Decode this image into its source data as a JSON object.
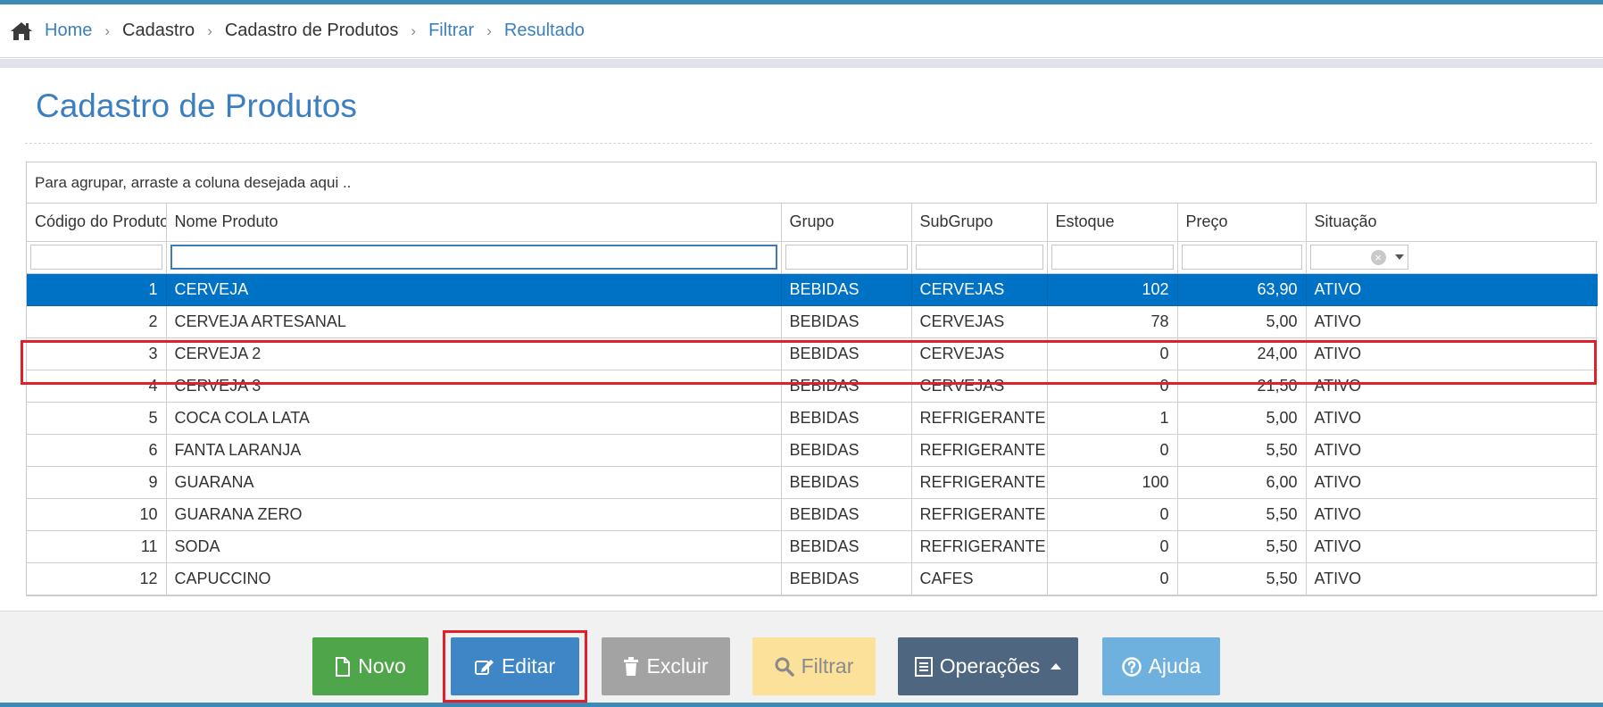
{
  "breadcrumb": {
    "items": [
      {
        "label": "Home"
      },
      {
        "label": "Cadastro"
      },
      {
        "label": "Cadastro de Produtos"
      },
      {
        "label": "Filtrar"
      },
      {
        "label": "Resultado"
      }
    ]
  },
  "page": {
    "title": "Cadastro de Produtos"
  },
  "grid": {
    "group_hint": "Para agrupar, arraste a coluna desejada aqui ..",
    "columns": [
      "Código do Produto",
      "Nome Produto",
      "Grupo",
      "SubGrupo",
      "Estoque",
      "Preço",
      "Situação"
    ],
    "rows": [
      {
        "codigo": "1",
        "nome": "CERVEJA",
        "grupo": "BEBIDAS",
        "subgrupo": "CERVEJAS",
        "estoque": "102",
        "preco": "63,90",
        "situacao": "ATIVO",
        "selected": true
      },
      {
        "codigo": "2",
        "nome": "CERVEJA ARTESANAL",
        "grupo": "BEBIDAS",
        "subgrupo": "CERVEJAS",
        "estoque": "78",
        "preco": "5,00",
        "situacao": "ATIVO"
      },
      {
        "codigo": "3",
        "nome": "CERVEJA 2",
        "grupo": "BEBIDAS",
        "subgrupo": "CERVEJAS",
        "estoque": "0",
        "preco": "24,00",
        "situacao": "ATIVO"
      },
      {
        "codigo": "4",
        "nome": "CERVEJA 3",
        "grupo": "BEBIDAS",
        "subgrupo": "CERVEJAS",
        "estoque": "0",
        "preco": "21,50",
        "situacao": "ATIVO"
      },
      {
        "codigo": "5",
        "nome": "COCA COLA LATA",
        "grupo": "BEBIDAS",
        "subgrupo": "REFRIGERANTE",
        "estoque": "1",
        "preco": "5,00",
        "situacao": "ATIVO"
      },
      {
        "codigo": "6",
        "nome": "FANTA LARANJA",
        "grupo": "BEBIDAS",
        "subgrupo": "REFRIGERANTE",
        "estoque": "0",
        "preco": "5,50",
        "situacao": "ATIVO"
      },
      {
        "codigo": "9",
        "nome": "GUARANA",
        "grupo": "BEBIDAS",
        "subgrupo": "REFRIGERANTE",
        "estoque": "100",
        "preco": "6,00",
        "situacao": "ATIVO"
      },
      {
        "codigo": "10",
        "nome": "GUARANA ZERO",
        "grupo": "BEBIDAS",
        "subgrupo": "REFRIGERANTE",
        "estoque": "0",
        "preco": "5,50",
        "situacao": "ATIVO"
      },
      {
        "codigo": "11",
        "nome": "SODA",
        "grupo": "BEBIDAS",
        "subgrupo": "REFRIGERANTE",
        "estoque": "0",
        "preco": "5,50",
        "situacao": "ATIVO"
      },
      {
        "codigo": "12",
        "nome": "CAPUCCINO",
        "grupo": "BEBIDAS",
        "subgrupo": "CAFES",
        "estoque": "0",
        "preco": "5,50",
        "situacao": "ATIVO"
      }
    ]
  },
  "toolbar": {
    "novo": {
      "label": "Novo",
      "icon": "file-icon",
      "color": "#4ea54a"
    },
    "editar": {
      "label": "Editar",
      "icon": "edit-icon",
      "color": "#3f86c6"
    },
    "excluir": {
      "label": "Excluir",
      "icon": "trash-icon",
      "color": "#a3a3a3"
    },
    "filtrar": {
      "label": "Filtrar",
      "icon": "search-icon",
      "color": "#fbe199"
    },
    "operacoes": {
      "label": "Operações",
      "icon": "list-icon",
      "color": "#4f6680"
    },
    "ajuda": {
      "label": "Ajuda",
      "icon": "help-icon",
      "color": "#6fb1de"
    }
  },
  "colors": {
    "accent": "#3b7fc0",
    "selected_row": "#0072c6",
    "highlight": "#e0202a"
  }
}
